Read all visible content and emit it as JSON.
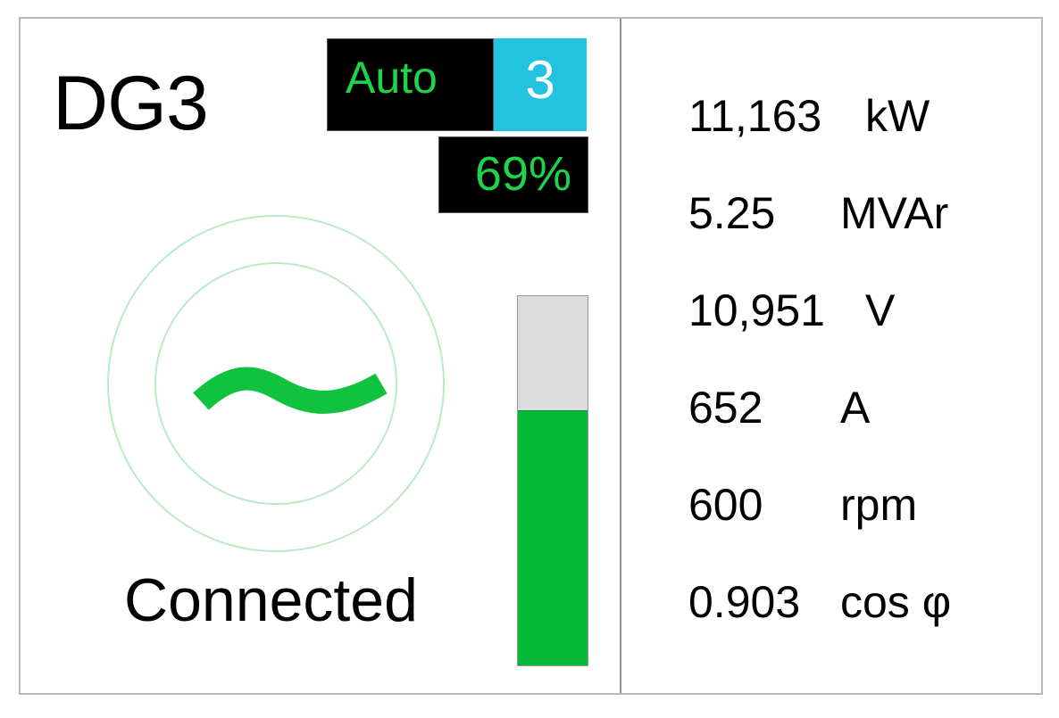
{
  "generator": {
    "name": "DG3",
    "mode": "Auto",
    "priority": "3",
    "load_percent_label": "69%",
    "load_fraction": 0.69,
    "status": "Connected",
    "symbol_icon": "ac-sine-wave-icon"
  },
  "colors": {
    "mode_text": "#1fd34b",
    "priority_bg": "#22c3e0",
    "bar_fill": "#06b838",
    "bar_track": "#dcdcdc",
    "symbol_green": "#11c23f",
    "ring_green": "#b8ecc4"
  },
  "readings": [
    {
      "value": "11,163",
      "unit": "kW"
    },
    {
      "value": "5.25",
      "unit": "MVAr"
    },
    {
      "value": "10,951",
      "unit": "V"
    },
    {
      "value": "652",
      "unit": "A"
    },
    {
      "value": "600",
      "unit": "rpm"
    },
    {
      "value": "0.903",
      "unit": "cos φ"
    }
  ]
}
